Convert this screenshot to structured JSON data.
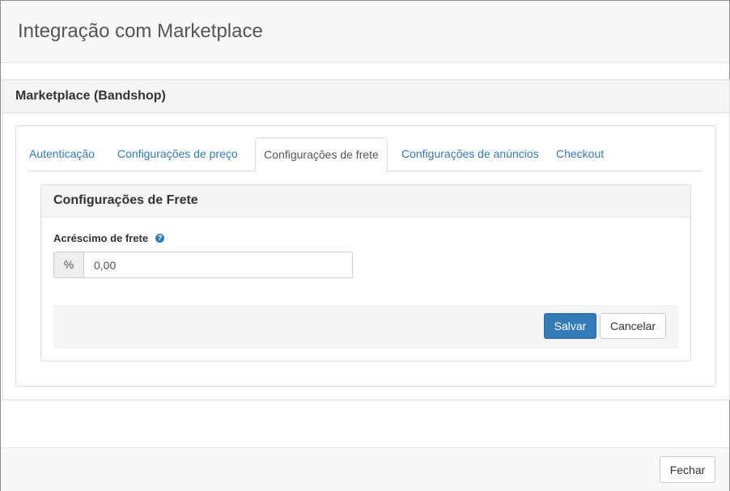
{
  "modal": {
    "title": "Integração com Marketplace",
    "close_label": "Fechar"
  },
  "panel": {
    "title": "Marketplace (Bandshop)"
  },
  "tabs": [
    {
      "label": "Autenticação",
      "active": false
    },
    {
      "label": "Configurações de preço",
      "active": false
    },
    {
      "label": "Configurações de frete",
      "active": true
    },
    {
      "label": "Configurações de anúncios",
      "active": false
    },
    {
      "label": "Checkout",
      "active": false
    }
  ],
  "frete": {
    "title": "Configurações de Frete",
    "field_label": "Acréscimo de frete",
    "help_icon": "question-circle-icon",
    "addon": "%",
    "value": "0,00",
    "save_label": "Salvar",
    "cancel_label": "Cancelar"
  },
  "colors": {
    "primary": "#337ab7",
    "link": "#337ab7",
    "header_bg": "#f7f8f8",
    "panel_heading_bg": "#f5f5f5"
  }
}
